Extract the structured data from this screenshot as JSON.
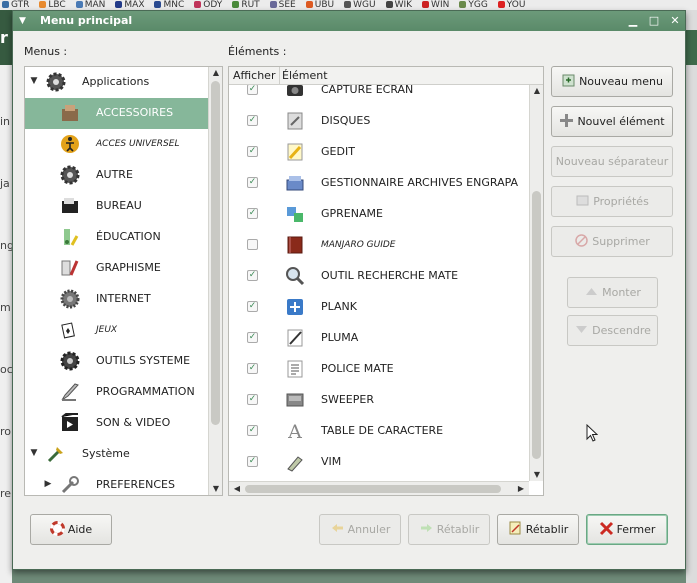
{
  "bookmarks": [
    {
      "label": "GTR",
      "color": "#3a6ea5"
    },
    {
      "label": "LBC",
      "color": "#e88a2e"
    },
    {
      "label": "MAN",
      "color": "#4a7ab5"
    },
    {
      "label": "MAX",
      "color": "#223a88"
    },
    {
      "label": "MNC",
      "color": "#2a4a90"
    },
    {
      "label": "ODY",
      "color": "#c0345a"
    },
    {
      "label": "RUT",
      "color": "#4a8a3a"
    },
    {
      "label": "SEE",
      "color": "#6a6a9a"
    },
    {
      "label": "UBU",
      "color": "#dd5a22"
    },
    {
      "label": "WGU",
      "color": "#555555"
    },
    {
      "label": "WIK",
      "color": "#444444"
    },
    {
      "label": "WIN",
      "color": "#cc2222"
    },
    {
      "label": "YGG",
      "color": "#6a8a4a"
    },
    {
      "label": "YOU",
      "color": "#dd2222"
    }
  ],
  "background": {
    "left_glimpses": [
      "in",
      "ja",
      "ng",
      "m",
      "oc",
      "ro",
      "re"
    ]
  },
  "window": {
    "title": "Menu principal",
    "menu_arrow": "▼",
    "minimize": "▁",
    "maximize": "□",
    "close": "✕"
  },
  "labels": {
    "menus": "Menus :",
    "elements": "Éléments :"
  },
  "tree": [
    {
      "label": "Applications",
      "icon": "gear-icon",
      "expander": "▼",
      "level": 0
    },
    {
      "label": "ACCESSOIRES",
      "icon": "accessories-icon",
      "level": 1,
      "selected": true
    },
    {
      "label": "ACCES UNIVERSEL",
      "icon": "accessibility-icon",
      "level": 1,
      "italic": true
    },
    {
      "label": "AUTRE",
      "icon": "gear-icon",
      "level": 1
    },
    {
      "label": "BUREAU",
      "icon": "office-icon",
      "level": 1
    },
    {
      "label": "ÉDUCATION",
      "icon": "education-icon",
      "level": 1
    },
    {
      "label": "GRAPHISME",
      "icon": "graphics-icon",
      "level": 1
    },
    {
      "label": "INTERNET",
      "icon": "internet-icon",
      "level": 1
    },
    {
      "label": "JEUX",
      "icon": "games-icon",
      "level": 1,
      "italic": true
    },
    {
      "label": "OUTILS SYSTEME",
      "icon": "system-tools-icon",
      "level": 1
    },
    {
      "label": "PROGRAMMATION",
      "icon": "programming-icon",
      "level": 1
    },
    {
      "label": "SON & VIDEO",
      "icon": "multimedia-icon",
      "level": 1
    },
    {
      "label": "Système",
      "icon": "system-icon",
      "expander": "▼",
      "level": 0
    },
    {
      "label": "PREFERENCES",
      "icon": "preferences-icon",
      "expander": "▶",
      "level": 1
    }
  ],
  "list": {
    "col_show": "Afficher",
    "col_element": "Élément",
    "rows": [
      {
        "label": "CAPTURE ECRAN",
        "icon": "screenshot-icon",
        "checked": true
      },
      {
        "label": "DISQUES",
        "icon": "disks-icon",
        "checked": true
      },
      {
        "label": "GEDIT",
        "icon": "gedit-icon",
        "checked": true
      },
      {
        "label": "GESTIONNAIRE ARCHIVES ENGRAPA",
        "icon": "archive-manager-icon",
        "checked": true
      },
      {
        "label": "GPRENAME",
        "icon": "gprename-icon",
        "checked": true
      },
      {
        "label": "MANJARO GUIDE",
        "icon": "book-icon",
        "checked": false,
        "italic": true
      },
      {
        "label": "OUTIL RECHERCHE MATE",
        "icon": "search-icon",
        "checked": true
      },
      {
        "label": "PLANK",
        "icon": "plank-icon",
        "checked": true
      },
      {
        "label": "PLUMA",
        "icon": "pluma-icon",
        "checked": true
      },
      {
        "label": "POLICE MATE",
        "icon": "font-icon",
        "checked": true
      },
      {
        "label": "SWEEPER",
        "icon": "sweeper-icon",
        "checked": true
      },
      {
        "label": "TABLE DE CARACTERE",
        "icon": "charmap-icon",
        "checked": true
      },
      {
        "label": "VIM",
        "icon": "vim-icon",
        "checked": true
      }
    ]
  },
  "buttons": {
    "new_menu": "Nouveau menu",
    "new_item": "Nouvel élément",
    "new_separator": "Nouveau séparateur",
    "properties": "Propriétés",
    "delete": "Supprimer",
    "move_up": "Monter",
    "move_down": "Descendre",
    "help": "Aide",
    "undo": "Annuler",
    "redo": "Rétablir",
    "revert": "Rétablir",
    "close": "Fermer"
  },
  "colors": {
    "title_bar": "#5f8f6e",
    "selection": "#86b79a",
    "check": "#3a8a55"
  }
}
